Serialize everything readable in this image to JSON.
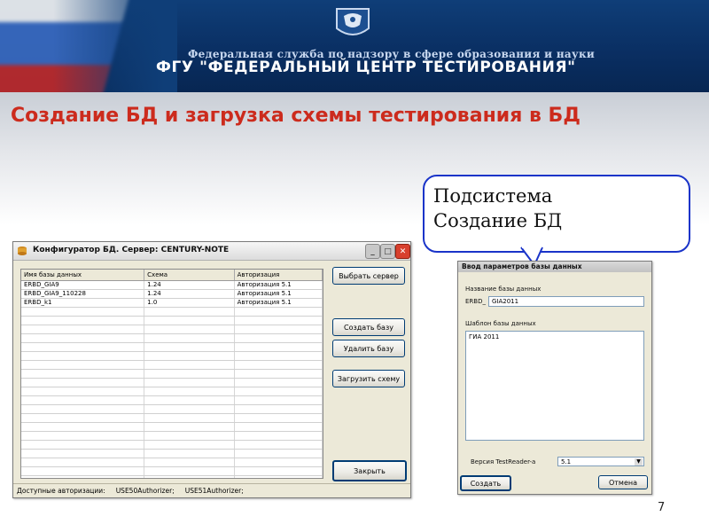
{
  "banner": {
    "subtitle": "Федеральная служба по надзору в сфере образования и науки",
    "title": "ФГУ \"ФЕДЕРАЛЬНЫЙ ЦЕНТР ТЕСТИРОВАНИЯ\""
  },
  "slide": {
    "title": "Создание БД и загрузка схемы тестирования в БД",
    "page_number": "7"
  },
  "callout": {
    "text": "Подсистема\nСоздание БД"
  },
  "configurator": {
    "title": "Конфигуратор БД. Сервер: CENTURY-NOTE",
    "columns": [
      "Имя базы данных",
      "Схема",
      "Авторизация"
    ],
    "rows": [
      [
        "ERBD_GIA9",
        "1.24",
        "Авторизация 5.1"
      ],
      [
        "ERBD_GIA9_110228",
        "1.24",
        "Авторизация 5.1"
      ],
      [
        "ERBD_k1",
        "1.0",
        "Авторизация 5.1"
      ]
    ],
    "buttons": {
      "select_server": "Выбрать сервер",
      "create_db": "Создать базу",
      "delete_db": "Удалить базу",
      "load_schema": "Загрузить схему",
      "close": "Закрыть"
    },
    "status": {
      "label": "Доступные авторизации:",
      "auth1": "USE50Authorizer;",
      "auth2": "USE51Authorizer;"
    }
  },
  "params_dialog": {
    "title": "Ввод параметров базы данных",
    "db_name_label": "Название базы данных",
    "db_prefix": "ERBD_",
    "db_name_value": "GIA2011",
    "template_label": "Шаблон базы данных",
    "template_value": "ГИА 2011",
    "version_label": "Версия TestReader-a",
    "version_value": "5.1",
    "create_button": "Создать",
    "cancel_button": "Отмена"
  },
  "colors": {
    "banner": "#0f3e78",
    "title_red": "#cc2b1d",
    "callout_border": "#1a34c9"
  }
}
